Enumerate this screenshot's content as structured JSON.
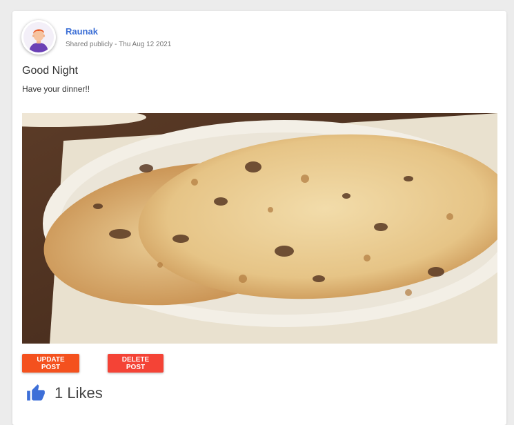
{
  "post": {
    "author": "Raunak",
    "visibility_text": "Shared publicly - Thu Aug 12 2021",
    "title": "Good Night",
    "body": "Have your dinner!!",
    "image_alt": "flatbread on a plate",
    "avatar_icon": "user-avatar-icon"
  },
  "actions": {
    "update_label": "UPDATE POST",
    "delete_label": "DELETE POST"
  },
  "likes": {
    "count_text": "1 Likes",
    "icon": "thumbs-up-icon"
  },
  "colors": {
    "author_link": "#3c6fd6",
    "update_button": "#f4511e",
    "delete_button": "#f44336",
    "like_icon": "#3d6fd8"
  }
}
